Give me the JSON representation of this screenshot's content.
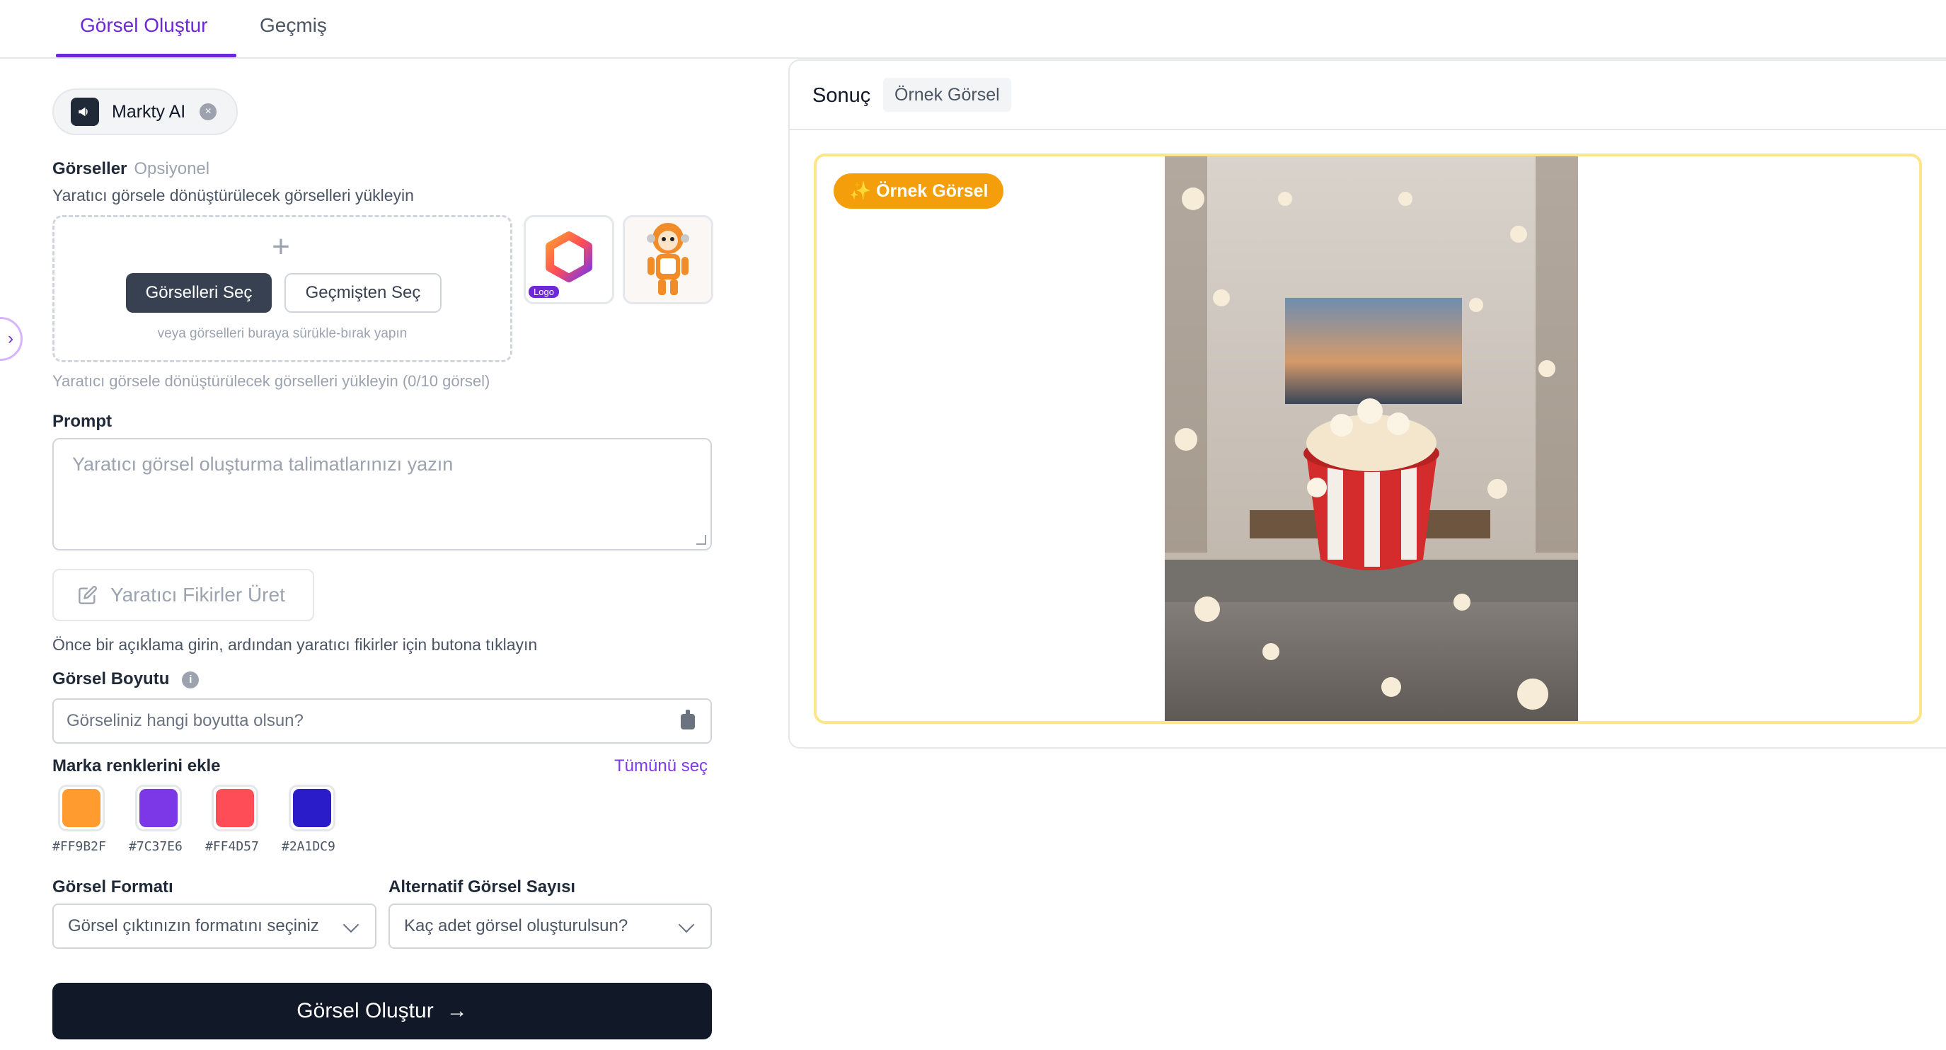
{
  "tabs": [
    {
      "label": "Görsel Oluştur"
    },
    {
      "label": "Geçmiş"
    }
  ],
  "brand_chip": {
    "name": "Markty AI"
  },
  "images": {
    "label": "Görseller",
    "optional": "Opsiyonel",
    "description": "Yaratıcı görsele dönüştürülecek görselleri yükleyin",
    "select_button": "Görselleri Seç",
    "history_button": "Geçmişten Seç",
    "drop_hint": "veya görselleri buraya sürükle-bırak yapın",
    "count_hint": "Yaratıcı görsele dönüştürülecek görselleri yükleyin (0/10 görsel)",
    "thumbs": [
      {
        "badge": "Logo",
        "icon": "hexagon-logo-icon"
      },
      {
        "icon": "robot-mascot-icon"
      }
    ]
  },
  "prompt": {
    "label": "Prompt",
    "placeholder": "Yaratıcı görsel oluşturma talimatlarınızı yazın"
  },
  "ideas": {
    "button": "Yaratıcı Fikirler Üret",
    "hint": "Önce bir açıklama girin, ardından yaratıcı fikirler için butona tıklayın"
  },
  "size": {
    "label": "Görsel Boyutu",
    "placeholder": "Görseliniz hangi boyutta olsun?"
  },
  "brand_colors": {
    "label": "Marka renklerini ekle",
    "select_all": "Tümünü seç",
    "colors": [
      {
        "hex": "#FF9B2F"
      },
      {
        "hex": "#7C37E6"
      },
      {
        "hex": "#FF4D57"
      },
      {
        "hex": "#2A1DC9"
      }
    ]
  },
  "format": {
    "label": "Görsel Formatı",
    "placeholder": "Görsel çıktınızın formatını seçiniz"
  },
  "alternatives": {
    "label": "Alternatif Görsel Sayısı",
    "placeholder": "Kaç adet görsel oluşturulsun?"
  },
  "generate_button": "Görsel Oluştur",
  "result": {
    "title": "Sonuç",
    "tag": "Örnek Görsel",
    "badge": "✨ Örnek Görsel"
  }
}
